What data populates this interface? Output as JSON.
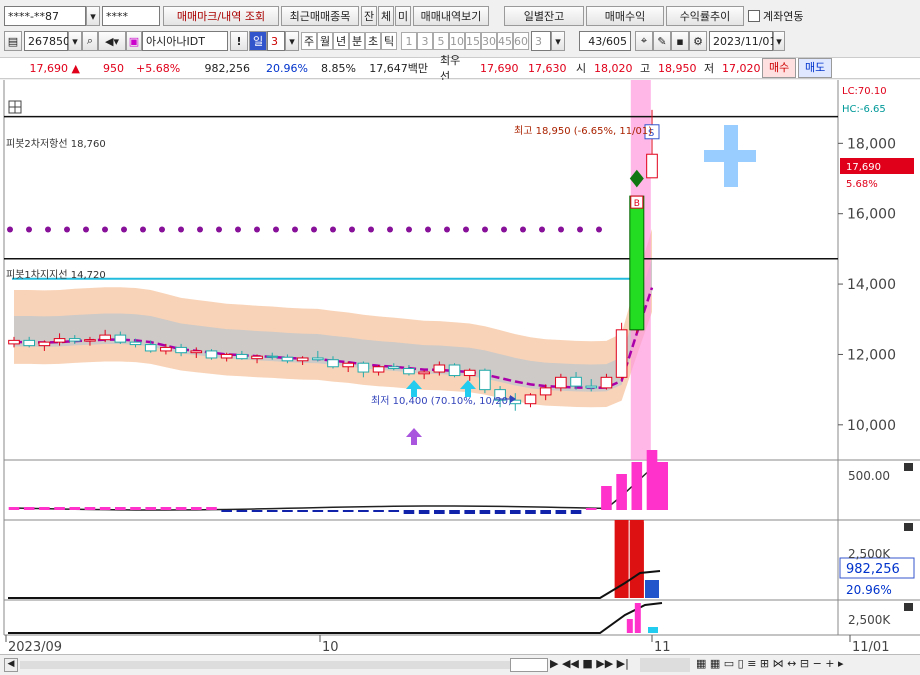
{
  "toolbar1": {
    "account": "****-**87",
    "password": "****",
    "mark_btn": "매매마크/내역 조회",
    "recent_btn": "최근매매종목",
    "jan": "잔",
    "che": "체",
    "mi": "미",
    "history_btn": "매매내역보기",
    "daily_btn": "일별잔고",
    "profit_btn": "매매수익",
    "rate_btn": "수익률추이",
    "link_label": "계좌연동"
  },
  "toolbar2": {
    "code": "267850",
    "name": "아시아나IDT",
    "excl": "!",
    "day": "일",
    "period_value": "3",
    "periods": [
      "주",
      "월",
      "년",
      "분",
      "초",
      "틱"
    ],
    "minutes": [
      "1",
      "3",
      "5",
      "10",
      "15",
      "30",
      "45",
      "60"
    ],
    "count_value": "3",
    "pages": "43/605",
    "date": "2023/11/01"
  },
  "quote": {
    "price": "17,690 ▲",
    "change": "950",
    "rate": "+5.68%",
    "volume": "982,256",
    "vol_rate": "20.96%",
    "turnover": "8.85%",
    "amount": "17,647백만",
    "best": "최우선",
    "ask": "17,690",
    "bid": "17,630",
    "open_label": "시",
    "open": "18,020",
    "high_label": "고",
    "high": "18,950",
    "low_label": "저",
    "low": "17,020",
    "buy": "매수",
    "sell": "매도"
  },
  "chart_data": {
    "type": "candlestick",
    "price_axis": {
      "ylim": [
        9000,
        19800
      ],
      "ticks": [
        "18,000",
        "16,000",
        "14,000",
        "12,000",
        "10,000"
      ]
    },
    "x_labels": [
      "2023/09",
      "10",
      "11",
      "11/01"
    ],
    "annotations": {
      "lc": "LC:70.10",
      "hc": "HC:-6.65",
      "pivot2": "피봇2차저항선 18,760",
      "pivot1": "피봇1차지지선 14,720",
      "high_note": "최고 18,950 (-6.65%, 11/01)",
      "low_note": "최저 10,400 (70.10%, 10/20)",
      "price_tag": "17,690",
      "price_pct": "5.68%",
      "s_mark": "S",
      "b_mark": "B"
    },
    "candles": [
      {
        "o": 12300,
        "h": 12500,
        "l": 12200,
        "c": 12400
      },
      {
        "o": 12400,
        "h": 12500,
        "l": 12200,
        "c": 12250
      },
      {
        "o": 12250,
        "h": 12400,
        "l": 12100,
        "c": 12350
      },
      {
        "o": 12350,
        "h": 12600,
        "l": 12250,
        "c": 12450
      },
      {
        "o": 12450,
        "h": 12550,
        "l": 12300,
        "c": 12380
      },
      {
        "o": 12380,
        "h": 12500,
        "l": 12250,
        "c": 12420
      },
      {
        "o": 12420,
        "h": 12700,
        "l": 12350,
        "c": 12550
      },
      {
        "o": 12550,
        "h": 12650,
        "l": 12300,
        "c": 12350
      },
      {
        "o": 12350,
        "h": 12450,
        "l": 12200,
        "c": 12280
      },
      {
        "o": 12280,
        "h": 12400,
        "l": 12050,
        "c": 12100
      },
      {
        "o": 12100,
        "h": 12300,
        "l": 12000,
        "c": 12200
      },
      {
        "o": 12200,
        "h": 12300,
        "l": 11950,
        "c": 12050
      },
      {
        "o": 12050,
        "h": 12200,
        "l": 11900,
        "c": 12100
      },
      {
        "o": 12100,
        "h": 12150,
        "l": 11850,
        "c": 11900
      },
      {
        "o": 11900,
        "h": 12050,
        "l": 11800,
        "c": 12000
      },
      {
        "o": 12000,
        "h": 12100,
        "l": 11850,
        "c": 11880
      },
      {
        "o": 11880,
        "h": 12000,
        "l": 11750,
        "c": 11950
      },
      {
        "o": 11950,
        "h": 12050,
        "l": 11850,
        "c": 11920
      },
      {
        "o": 11920,
        "h": 12000,
        "l": 11750,
        "c": 11820
      },
      {
        "o": 11820,
        "h": 11950,
        "l": 11700,
        "c": 11900
      },
      {
        "o": 11900,
        "h": 12100,
        "l": 11800,
        "c": 11850
      },
      {
        "o": 11850,
        "h": 11950,
        "l": 11600,
        "c": 11650
      },
      {
        "o": 11650,
        "h": 11800,
        "l": 11500,
        "c": 11750
      },
      {
        "o": 11750,
        "h": 11800,
        "l": 11350,
        "c": 11500
      },
      {
        "o": 11500,
        "h": 11700,
        "l": 11400,
        "c": 11650
      },
      {
        "o": 11650,
        "h": 11750,
        "l": 11550,
        "c": 11600
      },
      {
        "o": 11600,
        "h": 11700,
        "l": 11400,
        "c": 11450
      },
      {
        "o": 11450,
        "h": 11550,
        "l": 11300,
        "c": 11500
      },
      {
        "o": 11500,
        "h": 11800,
        "l": 11400,
        "c": 11700
      },
      {
        "o": 11700,
        "h": 11750,
        "l": 11350,
        "c": 11400
      },
      {
        "o": 11400,
        "h": 11600,
        "l": 11250,
        "c": 11550
      },
      {
        "o": 11550,
        "h": 11600,
        "l": 10900,
        "c": 11000
      },
      {
        "o": 11000,
        "h": 11100,
        "l": 10500,
        "c": 10700
      },
      {
        "o": 10700,
        "h": 10900,
        "l": 10400,
        "c": 10600
      },
      {
        "o": 10600,
        "h": 10900,
        "l": 10500,
        "c": 10850
      },
      {
        "o": 10850,
        "h": 11150,
        "l": 10700,
        "c": 11050
      },
      {
        "o": 11050,
        "h": 11450,
        "l": 10950,
        "c": 11350
      },
      {
        "o": 11350,
        "h": 11500,
        "l": 11000,
        "c": 11100
      },
      {
        "o": 11100,
        "h": 11300,
        "l": 10950,
        "c": 11050
      },
      {
        "o": 11050,
        "h": 11450,
        "l": 11000,
        "c": 11350
      },
      {
        "o": 11350,
        "h": 12900,
        "l": 11300,
        "c": 12700
      },
      {
        "o": 12700,
        "h": 16500,
        "l": 12600,
        "c": 16500
      },
      {
        "o": 17020,
        "h": 18950,
        "l": 17020,
        "c": 17690
      }
    ],
    "ma": [
      12350,
      12350,
      12340,
      12350,
      12380,
      12400,
      12420,
      12420,
      12400,
      12350,
      12250,
      12150,
      12100,
      12050,
      12000,
      11980,
      11950,
      11930,
      11900,
      11880,
      11870,
      11820,
      11780,
      11720,
      11680,
      11650,
      11610,
      11570,
      11560,
      11530,
      11500,
      11430,
      11330,
      11230,
      11150,
      11100,
      11080,
      11060,
      11050,
      11060,
      11250,
      12600,
      13900
    ],
    "indicator1": {
      "ticks": [
        "500.00"
      ]
    },
    "volume": {
      "value": "982,256",
      "rate": "20.96%",
      "ticks": [
        "2,500K",
        "2,500K"
      ]
    }
  },
  "colors": {
    "up": "#e0001a",
    "down": "#0033cc",
    "band": "#f7c8a5",
    "pink": "#ff66cc",
    "magenta": "#aa00aa"
  }
}
